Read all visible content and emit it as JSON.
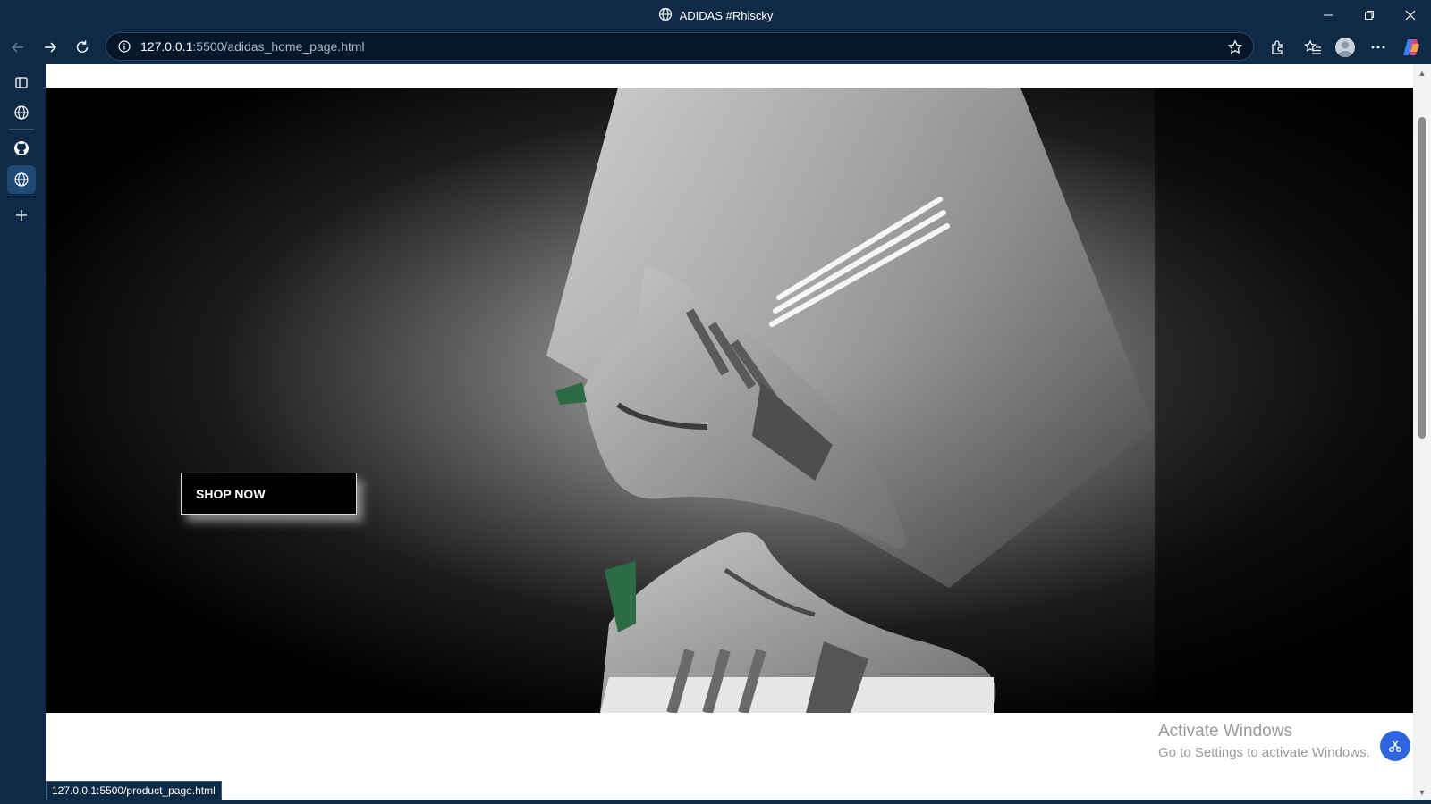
{
  "window": {
    "title": "ADIDAS #Rhiscky",
    "controls": [
      "minimize-icon",
      "restore-icon",
      "close-icon"
    ]
  },
  "toolbar": {
    "url_host": "127.0.0.1",
    "url_rest": ":5500/adidas_home_page.html",
    "icons": [
      "back-arrow-icon",
      "forward-arrow-icon",
      "refresh-icon",
      "info-icon",
      "star-icon",
      "extensions-icon",
      "favorites-icon",
      "profile-avatar",
      "more-icon",
      "copilot-icon"
    ]
  },
  "sidebar": {
    "items": [
      "tab-actions-icon",
      "globe-icon",
      "github-icon",
      "globe-icon-active",
      "plus-icon"
    ]
  },
  "page": {
    "hero_cta": "SHOP NOW",
    "colors": {
      "hero_bg": "#000000",
      "cta_bg": "#000000",
      "cta_text": "#ffffff",
      "fab": "#2f66e0"
    }
  },
  "status": {
    "link_preview": "127.0.0.1:5500/product_page.html"
  },
  "os_watermark": {
    "line1": "Activate Windows",
    "line2": "Go to Settings to activate Windows."
  }
}
